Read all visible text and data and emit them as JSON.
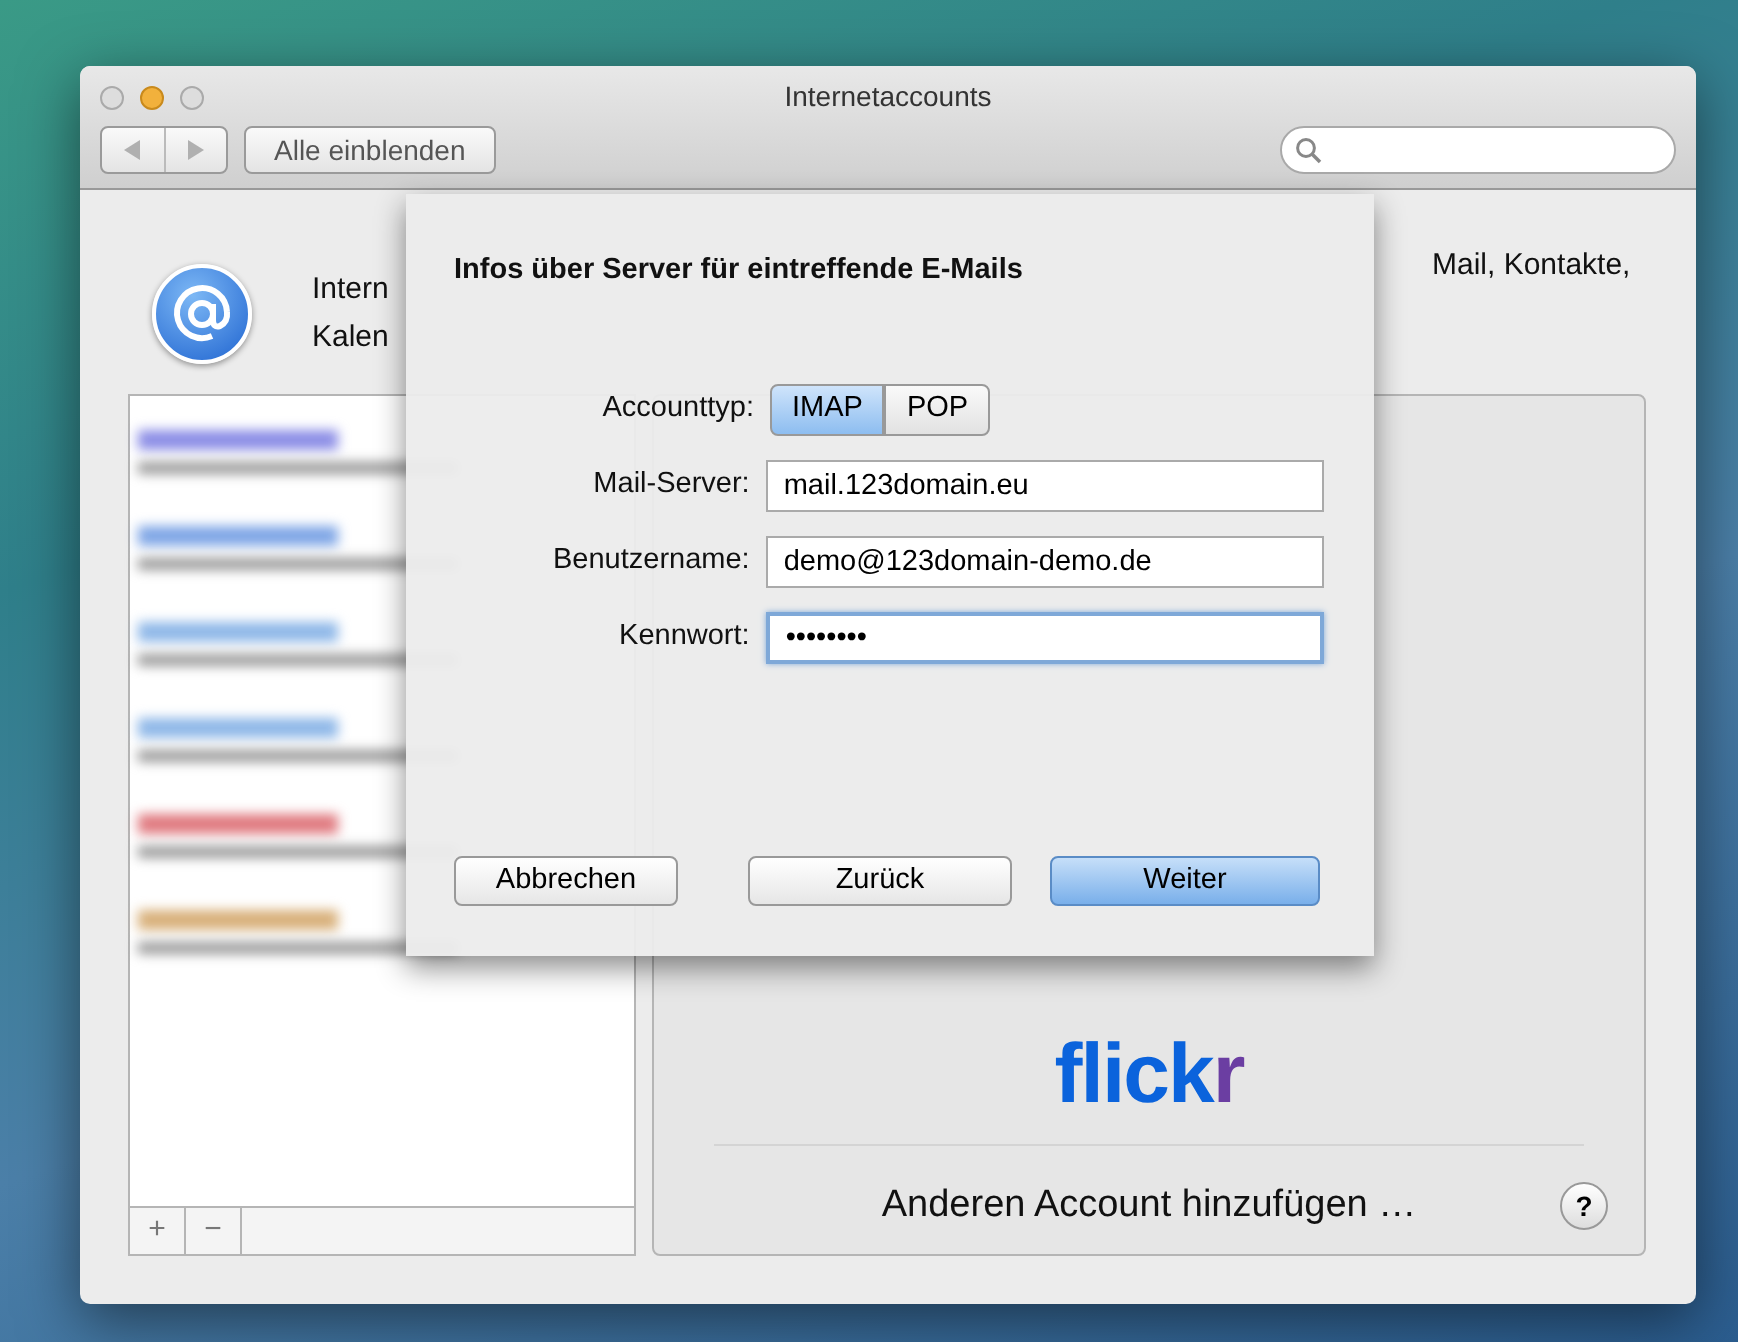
{
  "window": {
    "title": "Internetaccounts"
  },
  "toolbar": {
    "show_all_button": "Alle einblenden"
  },
  "header": {
    "fragments": [
      "Intern",
      "Kalen",
      "Mail, Kontakte,"
    ]
  },
  "accounts": [
    {
      "color": "#8c8ee6"
    },
    {
      "color": "#7fa6e6"
    },
    {
      "color": "#8fb8e8"
    },
    {
      "color": "#8fb8e8"
    },
    {
      "color": "#e07a80"
    },
    {
      "color": "#d8b07a"
    }
  ],
  "list_buttons": [
    "+",
    "−"
  ],
  "providers": {
    "logo": "flickr",
    "add_other": "Anderen Account hinzufügen …",
    "help": "?"
  },
  "sheet": {
    "title": "Infos über Server für eintreffende E-Mails",
    "account_type": {
      "label": "Accounttyp:",
      "options": [
        {
          "label": "IMAP",
          "selected": true
        },
        {
          "label": "POP",
          "selected": false
        }
      ]
    },
    "fields": [
      {
        "label": "Mail-Server:",
        "value": "mail.123domain.eu",
        "focused": false
      },
      {
        "label": "Benutzername:",
        "value": "demo@123domain-demo.de",
        "focused": false
      },
      {
        "label": "Kennwort:",
        "value": "••••••••",
        "focused": true
      }
    ],
    "buttons": [
      {
        "label": "Abbrechen",
        "kind": "normal"
      },
      {
        "label": "Zurück",
        "kind": "normal"
      },
      {
        "label": "Weiter",
        "kind": "default"
      }
    ]
  }
}
